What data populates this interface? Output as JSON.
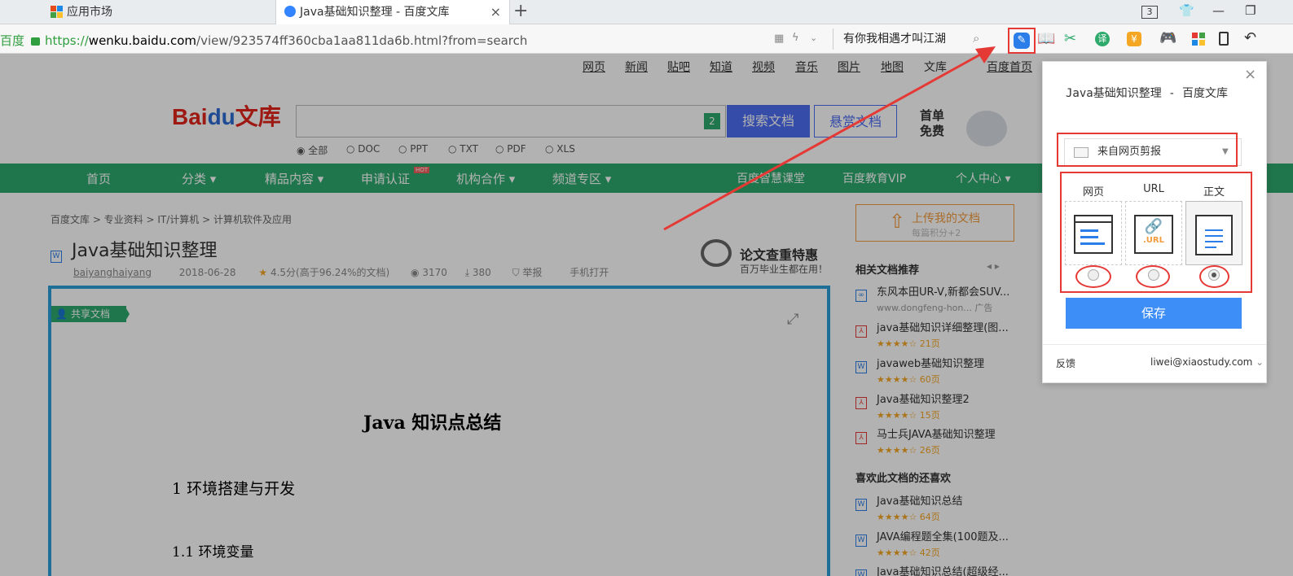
{
  "browser": {
    "tabs": [
      {
        "label": "应用市场"
      },
      {
        "label": "Java基础知识整理 - 百度文库"
      }
    ],
    "tab_close": "×",
    "new_tab": "+",
    "tab_count": "3",
    "url_prefix": "百度",
    "url_scheme": "https://",
    "url_host": "wenku.baidu.com",
    "url_path": "/view/923574ff360cba1aa811da6b.html?from=search",
    "search_text": "有你我相遇才叫江湖"
  },
  "page": {
    "top_nav": [
      "网页",
      "新闻",
      "贴吧",
      "知道",
      "视频",
      "音乐",
      "图片",
      "地图",
      "文库",
      "百度首页"
    ],
    "logo_text": "Bai",
    "logo_du": "du",
    "logo_wenku": "文库",
    "search_count": "2",
    "search_button": "搜索文档",
    "reward_button": "悬赏文档",
    "promo_banner": "首单免费",
    "file_types": [
      "全部",
      "DOC",
      "PPT",
      "TXT",
      "PDF",
      "XLS"
    ],
    "main_nav": [
      "首页",
      "分类",
      "精品内容",
      "申请认证",
      "机构合作",
      "频道专区",
      "百度智慧课堂",
      "百度教育VIP",
      "个人中心"
    ],
    "hot_badge": "HOT",
    "breadcrumb": "百度文库 > 专业资料 > IT/计算机 > 计算机软件及应用",
    "doc_title": "Java基础知识整理",
    "doc_author": "baiyanghaiyang",
    "doc_date": "2018-06-28",
    "doc_rating": "4.5分(高于96.24%的文档)",
    "doc_views": "3170",
    "doc_downloads": "380",
    "doc_report": "举报",
    "doc_mobile": "手机打开",
    "promo_title": "论文查重特惠",
    "promo_sub": "百万毕业生都在用！",
    "share_badge": "共享文档",
    "doc_h1": "Java 知识点总结",
    "doc_h2": "1    环境搭建与开发",
    "doc_h3": "1.1    环境变量",
    "upload_title": "上传我的文档",
    "upload_sub": "每篇积分+2",
    "related_title": "相关文档推荐",
    "related": [
      {
        "title": "东风本田UR-V,新都会SUV...",
        "sub": "www.dongfeng-hon...  广告"
      },
      {
        "title": "java基础知识详细整理(图...",
        "sub": "★★★★☆  21页"
      },
      {
        "title": "javaweb基础知识整理",
        "sub": "★★★★☆  60页"
      },
      {
        "title": "Java基础知识整理2",
        "sub": "★★★★☆  15页"
      },
      {
        "title": "马士兵JAVA基础知识整理",
        "sub": "★★★★☆  26页"
      }
    ],
    "like_title": "喜欢此文档的还喜欢",
    "liked": [
      {
        "title": "Java基础知识总结",
        "sub": "★★★★☆  64页"
      },
      {
        "title": "JAVA编程题全集(100题及...",
        "sub": "★★★★☆  42页"
      },
      {
        "title": "Java基础知识总结(超级经...",
        "sub": ""
      }
    ]
  },
  "popup": {
    "title": "Java基础知识整理 - 百度文库",
    "close": "×",
    "folder": "来自网页剪报",
    "modes": [
      "网页",
      "URL",
      "正文"
    ],
    "url_icon_text": ".URL",
    "selected_mode": "正文",
    "save": "保存",
    "feedback": "反馈",
    "account": "liwei@xiaostudy.com"
  },
  "colors": {
    "accent": "#3e8ef7",
    "annotation": "#e53935",
    "wenku_green": "#2eaa6d"
  }
}
